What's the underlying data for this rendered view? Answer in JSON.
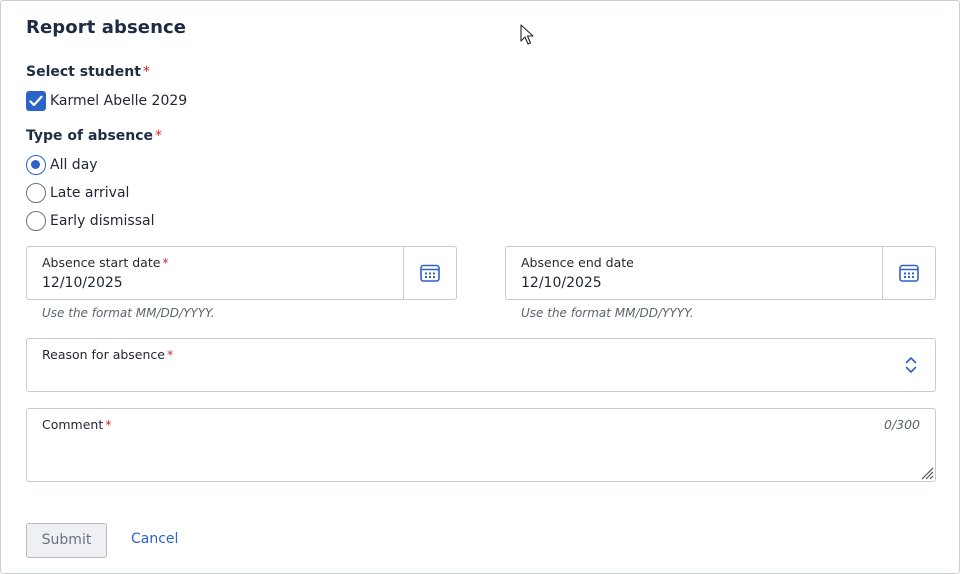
{
  "dialog": {
    "title": "Report absence"
  },
  "select_student": {
    "label": "Select student",
    "required_mark": "*",
    "option": {
      "label": "Karmel Abelle 2029",
      "checked": true
    }
  },
  "absence_type": {
    "label": "Type of absence",
    "required_mark": "*",
    "options": [
      {
        "label": "All day",
        "selected": true
      },
      {
        "label": "Late arrival",
        "selected": false
      },
      {
        "label": "Early dismissal",
        "selected": false
      }
    ]
  },
  "start_date": {
    "label": "Absence start date",
    "required_mark": "*",
    "value": "12/10/2025",
    "hint": "Use the format MM/DD/YYYY.",
    "icon": "calendar-icon"
  },
  "end_date": {
    "label": "Absence end date",
    "value": "12/10/2025",
    "hint": "Use the format MM/DD/YYYY.",
    "icon": "calendar-icon"
  },
  "reason": {
    "label": "Reason for absence",
    "required_mark": "*",
    "value": "",
    "icon": "select-arrows-icon"
  },
  "comment": {
    "label": "Comment",
    "required_mark": "*",
    "value": "",
    "counter": "0/300"
  },
  "actions": {
    "submit_label": "Submit",
    "cancel_label": "Cancel"
  },
  "colors": {
    "accent": "#2c63c9",
    "required": "#d12c2c",
    "title": "#1d2b45",
    "border": "#c4cbd3"
  }
}
